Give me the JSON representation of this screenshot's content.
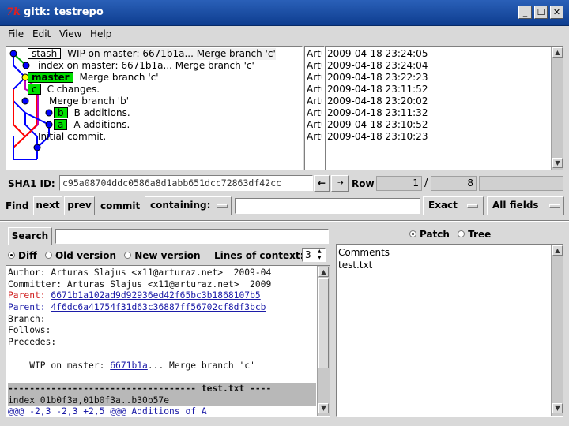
{
  "window": {
    "title": "gitk: testrepo",
    "tk_label": "7k"
  },
  "menu": [
    "File",
    "Edit",
    "View",
    "Help"
  ],
  "commits": [
    {
      "tags": [
        {
          "name": "stash",
          "style": "stash"
        }
      ],
      "message": "WIP on master: 6671b1a... Merge branch 'c'",
      "author": "Arturas",
      "date": "2009-04-18 23:24:05"
    },
    {
      "tags": [],
      "message": "index on master: 6671b1a... Merge branch 'c'",
      "author": "Arturas",
      "date": "2009-04-18 23:24:04"
    },
    {
      "tags": [
        {
          "name": "master",
          "style": "green"
        }
      ],
      "message": "Merge branch 'c'",
      "author": "Arturas",
      "date": "2009-04-18 23:22:23"
    },
    {
      "tags": [
        {
          "name": "c",
          "style": "green"
        }
      ],
      "message": "C changes.",
      "author": "Arturas",
      "date": "2009-04-18 23:11:52"
    },
    {
      "tags": [],
      "message": "Merge branch 'b'",
      "author": "Arturas",
      "date": "2009-04-18 23:20:02"
    },
    {
      "tags": [
        {
          "name": "b",
          "style": "green"
        }
      ],
      "message": "B additions.",
      "author": "Arturas",
      "date": "2009-04-18 23:11:32"
    },
    {
      "tags": [
        {
          "name": "a",
          "style": "green"
        }
      ],
      "message": "A additions.",
      "author": "Arturas",
      "date": "2009-04-18 23:10:52"
    },
    {
      "tags": [],
      "message": "Initial commit.",
      "author": "Arturas",
      "date": "2009-04-18 23:10:23"
    }
  ],
  "sha_bar": {
    "label": "SHA1 ID:",
    "sha": "c95a08704ddc0586a8d1abb651dcc72863df42cc",
    "row_label": "Row",
    "row": "1",
    "sep": "/",
    "total": "8"
  },
  "find_bar": {
    "find": "Find",
    "next": "next",
    "prev": "prev",
    "commit": "commit",
    "containing": "containing:",
    "exact": "Exact",
    "fields": "All fields"
  },
  "search": {
    "button": "Search"
  },
  "diff_options": {
    "diff": "Diff",
    "old": "Old version",
    "new": "New version",
    "context_label": "Lines of context:",
    "context_value": "3"
  },
  "patch_tree": {
    "patch": "Patch",
    "tree": "Tree"
  },
  "diff": {
    "author": "Author: Arturas Slajus <x11@arturaz.net>  2009-04",
    "committer": "Committer: Arturas Slajus <x11@arturaz.net>  2009",
    "parent1_label": "Parent:",
    "parent1": "6671b1a102ad9d92936ed42f65bc3b1868107b5",
    "parent2_label": "Parent:",
    "parent2": "4f6dc6a41754f31d63c36887ff56702cf8df3bcb",
    "branch": "Branch:",
    "follows": "Follows:",
    "precedes": "Precedes:",
    "wip_prefix": "    WIP on master: ",
    "wip_link": "6671b1a",
    "wip_suffix": "... Merge branch 'c'",
    "file_header": "----------------------------------- test.txt ----",
    "index_line": "index 01b0f3a,01b0f3a..b30b57e",
    "hunk": "@@@ -2,3 -2,3 +2,5 @@@ Additions of A"
  },
  "files": {
    "items": [
      "Comments",
      "test.txt"
    ]
  },
  "colors": {
    "titlebar": "#1b4ea6",
    "tag_green": "#00e000",
    "tag_yellow": "#ffff00",
    "link": "#1c1ca8",
    "graph_blue": "#0000ff",
    "graph_red": "#ff0000",
    "graph_green": "#00b000",
    "graph_magenta": "#c000c0"
  }
}
